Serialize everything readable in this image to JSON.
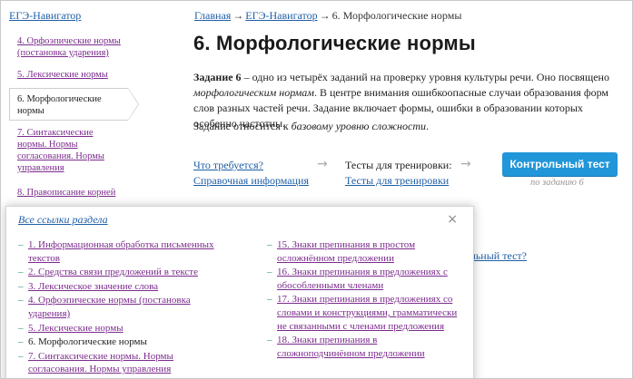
{
  "sidebar": {
    "title": "ЕГЭ-Навигатор",
    "items": [
      {
        "label": "4. Орфоэпические нормы (постановка ударения)",
        "visited": true
      },
      {
        "label": "5. Лексические нормы",
        "visited": true
      },
      {
        "label": "6. Морфологические нормы",
        "active": true
      },
      {
        "label": "7. Синтаксические нормы. Нормы согласования. Нормы управления",
        "visited": true
      },
      {
        "label": "8. Правописание корней",
        "visited": true
      }
    ]
  },
  "breadcrumb": {
    "home": "Главная",
    "sep": "→",
    "section": "ЕГЭ-Навигатор",
    "current": "6. Морфологические нормы"
  },
  "page": {
    "title": "6. Морфологические нормы",
    "intro_bold": "Задание 6",
    "intro_rest": " – одно из четырёх заданий на проверку уровня культуры речи. Оно посвящено ",
    "intro_italic": "морфологическим нормам",
    "intro_end": ". В центре внимания ошибкоопасные случаи образования форм слов разных частей речи. Задание включает формы, ошибки в образовании которых особенно частотны.",
    "level_prefix": "Задание относится к ",
    "level_italic": "базовому уровню сложности",
    "level_end": "."
  },
  "steps": {
    "what_required": "Что требуется?",
    "reference": "Справочная информация",
    "arrow": "→",
    "tests_label": "Тесты для тренировки:",
    "tests_link": "Тесты для тренировки",
    "control_test": "Контрольный тест",
    "by_task": "по заданию 6",
    "hidden_link": "ольный тест?"
  },
  "popup": {
    "title": "Все ссылки раздела",
    "close": "×",
    "dash": "–",
    "left": [
      {
        "label": "1. Информационная обработка письменных текстов",
        "link": true
      },
      {
        "label": "2. Средства связи предложений в тексте",
        "link": true
      },
      {
        "label": "3. Лексическое значение слова",
        "link": true
      },
      {
        "label": "4. Орфоэпические нормы (постановка ударения)",
        "link": true
      },
      {
        "label": "5. Лексические нормы",
        "link": true
      },
      {
        "label": "6. Морфологические нормы",
        "link": false
      },
      {
        "label": "7. Синтаксические нормы. Нормы согласования. Нормы управления",
        "link": true
      }
    ],
    "right": [
      {
        "label": "15. Знаки препинания в простом осложнённом предложении",
        "link": true
      },
      {
        "label": "16. Знаки препинания в предложениях с обособленными членами",
        "link": true
      },
      {
        "label": "17. Знаки препинания в предложениях со словами и конструкциями, грамматически не связанными с членами предложения",
        "link": true
      },
      {
        "label": "18. Знаки препинания в сложноподчинённом предложении",
        "link": true
      }
    ]
  },
  "colors": {
    "link": "#1f5fa6",
    "visited": "#7b2b8c",
    "button": "#2196d9"
  }
}
